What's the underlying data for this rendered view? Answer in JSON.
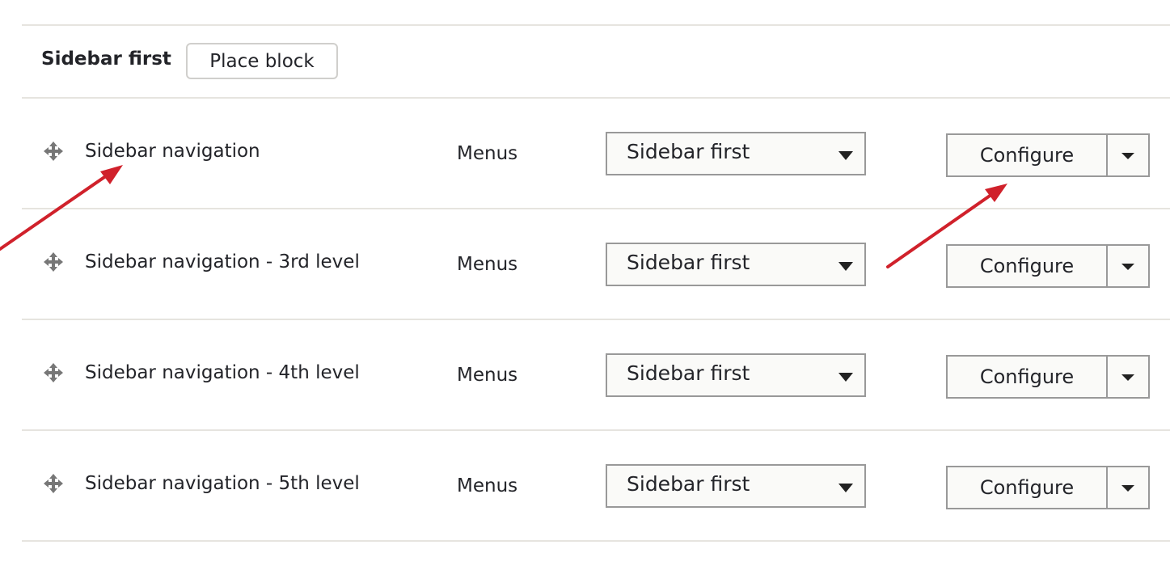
{
  "region": {
    "title": "Sidebar first",
    "place_block_label": "Place block"
  },
  "blocks": [
    {
      "name": "Sidebar navigation",
      "category": "Menus",
      "region_select": "Sidebar first",
      "action_label": "Configure"
    },
    {
      "name": "Sidebar navigation - 3rd level",
      "category": "Menus",
      "region_select": "Sidebar first",
      "action_label": "Configure"
    },
    {
      "name": "Sidebar navigation - 4th level",
      "category": "Menus",
      "region_select": "Sidebar first",
      "action_label": "Configure"
    },
    {
      "name": "Sidebar navigation - 5th level",
      "category": "Menus",
      "region_select": "Sidebar first",
      "action_label": "Configure"
    }
  ],
  "annotations": {
    "arrow_color": "#d0212b"
  }
}
